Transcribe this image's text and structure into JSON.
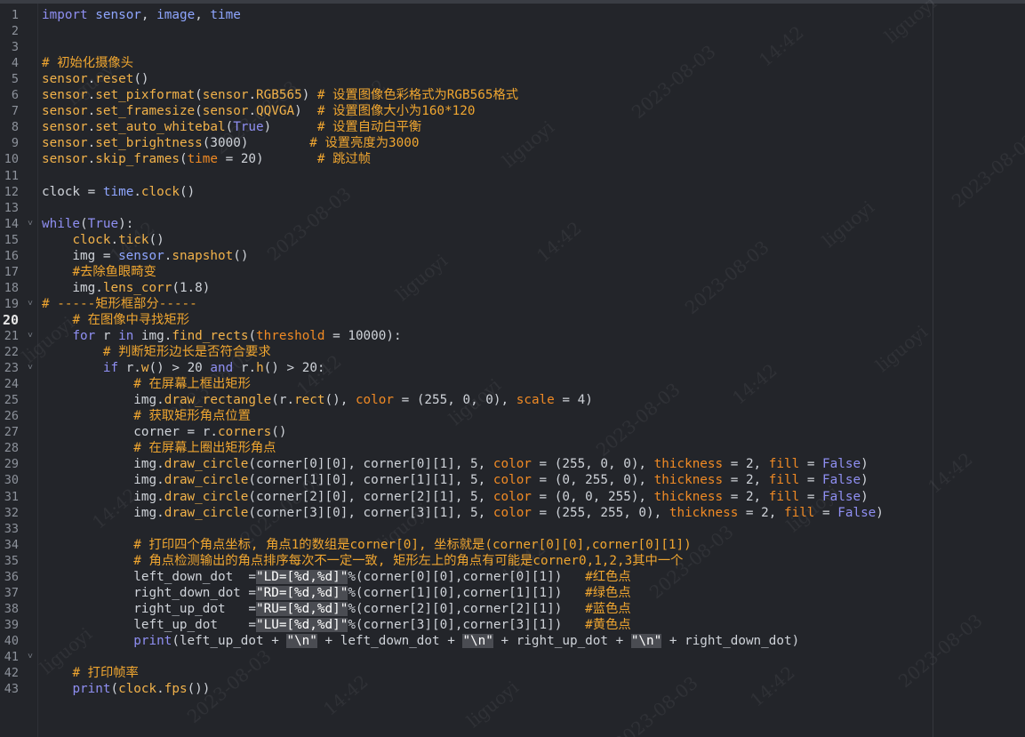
{
  "editor": {
    "current_line": 20,
    "watermarks": [
      "liguoyi",
      "2023-08-03",
      "14:42"
    ],
    "lines": [
      {
        "n": "1",
        "fold": "",
        "tokens": [
          [
            "kw",
            "import"
          ],
          [
            "def",
            " "
          ],
          [
            "mod",
            "sensor"
          ],
          [
            "def",
            ", "
          ],
          [
            "mod",
            "image"
          ],
          [
            "def",
            ", "
          ],
          [
            "mod",
            "time"
          ]
        ]
      },
      {
        "n": "2",
        "fold": "",
        "tokens": []
      },
      {
        "n": "3",
        "fold": "",
        "tokens": []
      },
      {
        "n": "4",
        "fold": "",
        "tokens": [
          [
            "cmt",
            "# 初始化摄像头"
          ]
        ]
      },
      {
        "n": "5",
        "fold": "",
        "tokens": [
          [
            "fn",
            "sensor"
          ],
          [
            "def",
            "."
          ],
          [
            "fn",
            "reset"
          ],
          [
            "def",
            "()"
          ]
        ]
      },
      {
        "n": "6",
        "fold": "",
        "tokens": [
          [
            "fn",
            "sensor"
          ],
          [
            "def",
            "."
          ],
          [
            "fn",
            "set_pixformat"
          ],
          [
            "def",
            "("
          ],
          [
            "fn",
            "sensor"
          ],
          [
            "def",
            "."
          ],
          [
            "fn",
            "RGB565"
          ],
          [
            "def",
            ") "
          ],
          [
            "cmt",
            "# 设置图像色彩格式为RGB565格式"
          ]
        ]
      },
      {
        "n": "7",
        "fold": "",
        "tokens": [
          [
            "fn",
            "sensor"
          ],
          [
            "def",
            "."
          ],
          [
            "fn",
            "set_framesize"
          ],
          [
            "def",
            "("
          ],
          [
            "fn",
            "sensor"
          ],
          [
            "def",
            "."
          ],
          [
            "fn",
            "QQVGA"
          ],
          [
            "def",
            ")  "
          ],
          [
            "cmt",
            "# 设置图像大小为160*120"
          ]
        ]
      },
      {
        "n": "8",
        "fold": "",
        "tokens": [
          [
            "fn",
            "sensor"
          ],
          [
            "def",
            "."
          ],
          [
            "fn",
            "set_auto_whitebal"
          ],
          [
            "def",
            "("
          ],
          [
            "const",
            "True"
          ],
          [
            "def",
            ")      "
          ],
          [
            "cmt",
            "# 设置自动白平衡"
          ]
        ]
      },
      {
        "n": "9",
        "fold": "",
        "tokens": [
          [
            "fn",
            "sensor"
          ],
          [
            "def",
            "."
          ],
          [
            "fn",
            "set_brightness"
          ],
          [
            "def",
            "(3000)        "
          ],
          [
            "cmt",
            "# 设置亮度为3000"
          ]
        ]
      },
      {
        "n": "10",
        "fold": "",
        "tokens": [
          [
            "fn",
            "sensor"
          ],
          [
            "def",
            "."
          ],
          [
            "fn",
            "skip_frames"
          ],
          [
            "def",
            "("
          ],
          [
            "kwarg",
            "time"
          ],
          [
            "def",
            " = 20)       "
          ],
          [
            "cmt",
            "# 跳过帧"
          ]
        ]
      },
      {
        "n": "11",
        "fold": "",
        "tokens": []
      },
      {
        "n": "12",
        "fold": "",
        "tokens": [
          [
            "def",
            "clock = "
          ],
          [
            "mod",
            "time"
          ],
          [
            "def",
            "."
          ],
          [
            "fn",
            "clock"
          ],
          [
            "def",
            "()"
          ]
        ]
      },
      {
        "n": "13",
        "fold": "",
        "tokens": []
      },
      {
        "n": "14",
        "fold": "v",
        "tokens": [
          [
            "kw",
            "while"
          ],
          [
            "def",
            "("
          ],
          [
            "const",
            "True"
          ],
          [
            "def",
            "):"
          ]
        ]
      },
      {
        "n": "15",
        "fold": "",
        "tokens": [
          [
            "def",
            "    "
          ],
          [
            "fn",
            "clock"
          ],
          [
            "def",
            "."
          ],
          [
            "fn",
            "tick"
          ],
          [
            "def",
            "()"
          ]
        ]
      },
      {
        "n": "16",
        "fold": "",
        "tokens": [
          [
            "def",
            "    img = "
          ],
          [
            "mod",
            "sensor"
          ],
          [
            "def",
            "."
          ],
          [
            "fn",
            "snapshot"
          ],
          [
            "def",
            "()"
          ]
        ]
      },
      {
        "n": "17",
        "fold": "",
        "tokens": [
          [
            "def",
            "    "
          ],
          [
            "cmt",
            "#去除鱼眼畸变"
          ]
        ]
      },
      {
        "n": "18",
        "fold": "",
        "tokens": [
          [
            "def",
            "    img."
          ],
          [
            "fn",
            "lens_corr"
          ],
          [
            "def",
            "(1.8)"
          ]
        ]
      },
      {
        "n": "19",
        "fold": "v",
        "tokens": [
          [
            "cmt",
            "# -----矩形框部分-----"
          ]
        ]
      },
      {
        "n": "20",
        "fold": "",
        "tokens": [
          [
            "def",
            "    "
          ],
          [
            "cmt",
            "# 在图像中寻找矩形"
          ]
        ]
      },
      {
        "n": "21",
        "fold": "v",
        "tokens": [
          [
            "def",
            "    "
          ],
          [
            "kw",
            "for"
          ],
          [
            "def",
            " r "
          ],
          [
            "kw",
            "in"
          ],
          [
            "def",
            " img."
          ],
          [
            "fn",
            "find_rects"
          ],
          [
            "def",
            "("
          ],
          [
            "kwarg",
            "threshold"
          ],
          [
            "def",
            " = 10000):"
          ]
        ]
      },
      {
        "n": "22",
        "fold": "",
        "tokens": [
          [
            "def",
            "        "
          ],
          [
            "cmt",
            "# 判断矩形边长是否符合要求"
          ]
        ]
      },
      {
        "n": "23",
        "fold": "v",
        "tokens": [
          [
            "def",
            "        "
          ],
          [
            "kw",
            "if"
          ],
          [
            "def",
            " r."
          ],
          [
            "fn",
            "w"
          ],
          [
            "def",
            "() > 20 "
          ],
          [
            "kw",
            "and"
          ],
          [
            "def",
            " r."
          ],
          [
            "fn",
            "h"
          ],
          [
            "def",
            "() > 20:"
          ]
        ]
      },
      {
        "n": "24",
        "fold": "",
        "tokens": [
          [
            "def",
            "            "
          ],
          [
            "cmt",
            "# 在屏幕上框出矩形"
          ]
        ]
      },
      {
        "n": "25",
        "fold": "",
        "tokens": [
          [
            "def",
            "            img."
          ],
          [
            "fn",
            "draw_rectangle"
          ],
          [
            "def",
            "(r."
          ],
          [
            "fn",
            "rect"
          ],
          [
            "def",
            "(), "
          ],
          [
            "kwarg",
            "color"
          ],
          [
            "def",
            " = (255, 0, 0), "
          ],
          [
            "kwarg",
            "scale"
          ],
          [
            "def",
            " = 4)"
          ]
        ]
      },
      {
        "n": "26",
        "fold": "",
        "tokens": [
          [
            "def",
            "            "
          ],
          [
            "cmt",
            "# 获取矩形角点位置"
          ]
        ]
      },
      {
        "n": "27",
        "fold": "",
        "tokens": [
          [
            "def",
            "            corner = r."
          ],
          [
            "fn",
            "corners"
          ],
          [
            "def",
            "()"
          ]
        ]
      },
      {
        "n": "28",
        "fold": "",
        "tokens": [
          [
            "def",
            "            "
          ],
          [
            "cmt",
            "# 在屏幕上圈出矩形角点"
          ]
        ]
      },
      {
        "n": "29",
        "fold": "",
        "tokens": [
          [
            "def",
            "            img."
          ],
          [
            "fn",
            "draw_circle"
          ],
          [
            "def",
            "(corner[0][0], corner[0][1], 5, "
          ],
          [
            "kwarg",
            "color"
          ],
          [
            "def",
            " = (255, 0, 0), "
          ],
          [
            "kwarg",
            "thickness"
          ],
          [
            "def",
            " = 2, "
          ],
          [
            "kwarg",
            "fill"
          ],
          [
            "def",
            " = "
          ],
          [
            "const",
            "False"
          ],
          [
            "def",
            ")"
          ]
        ]
      },
      {
        "n": "30",
        "fold": "",
        "tokens": [
          [
            "def",
            "            img."
          ],
          [
            "fn",
            "draw_circle"
          ],
          [
            "def",
            "(corner[1][0], corner[1][1], 5, "
          ],
          [
            "kwarg",
            "color"
          ],
          [
            "def",
            " = (0, 255, 0), "
          ],
          [
            "kwarg",
            "thickness"
          ],
          [
            "def",
            " = 2, "
          ],
          [
            "kwarg",
            "fill"
          ],
          [
            "def",
            " = "
          ],
          [
            "const",
            "False"
          ],
          [
            "def",
            ")"
          ]
        ]
      },
      {
        "n": "31",
        "fold": "",
        "tokens": [
          [
            "def",
            "            img."
          ],
          [
            "fn",
            "draw_circle"
          ],
          [
            "def",
            "(corner[2][0], corner[2][1], 5, "
          ],
          [
            "kwarg",
            "color"
          ],
          [
            "def",
            " = (0, 0, 255), "
          ],
          [
            "kwarg",
            "thickness"
          ],
          [
            "def",
            " = 2, "
          ],
          [
            "kwarg",
            "fill"
          ],
          [
            "def",
            " = "
          ],
          [
            "const",
            "False"
          ],
          [
            "def",
            ")"
          ]
        ]
      },
      {
        "n": "32",
        "fold": "",
        "tokens": [
          [
            "def",
            "            img."
          ],
          [
            "fn",
            "draw_circle"
          ],
          [
            "def",
            "(corner[3][0], corner[3][1], 5, "
          ],
          [
            "kwarg",
            "color"
          ],
          [
            "def",
            " = (255, 255, 0), "
          ],
          [
            "kwarg",
            "thickness"
          ],
          [
            "def",
            " = 2, "
          ],
          [
            "kwarg",
            "fill"
          ],
          [
            "def",
            " = "
          ],
          [
            "const",
            "False"
          ],
          [
            "def",
            ")"
          ]
        ]
      },
      {
        "n": "33",
        "fold": "",
        "tokens": []
      },
      {
        "n": "34",
        "fold": "",
        "tokens": [
          [
            "def",
            "            "
          ],
          [
            "cmt",
            "# 打印四个角点坐标, 角点1的数组是corner[0], 坐标就是(corner[0][0],corner[0][1])"
          ]
        ]
      },
      {
        "n": "35",
        "fold": "",
        "tokens": [
          [
            "def",
            "            "
          ],
          [
            "cmt",
            "# 角点检测输出的角点排序每次不一定一致, 矩形左上的角点有可能是corner0,1,2,3其中一个"
          ]
        ]
      },
      {
        "n": "36",
        "fold": "",
        "tokens": [
          [
            "def",
            "            left_down_dot  ="
          ],
          [
            "str",
            "\"LD=[%d,%d]\""
          ],
          [
            "def",
            "%(corner[0][0],corner[0][1])   "
          ],
          [
            "cmt",
            "#红色点"
          ]
        ]
      },
      {
        "n": "37",
        "fold": "",
        "tokens": [
          [
            "def",
            "            right_down_dot ="
          ],
          [
            "str",
            "\"RD=[%d,%d]\""
          ],
          [
            "def",
            "%(corner[1][0],corner[1][1])   "
          ],
          [
            "cmt",
            "#绿色点"
          ]
        ]
      },
      {
        "n": "38",
        "fold": "",
        "tokens": [
          [
            "def",
            "            right_up_dot   ="
          ],
          [
            "str",
            "\"RU=[%d,%d]\""
          ],
          [
            "def",
            "%(corner[2][0],corner[2][1])   "
          ],
          [
            "cmt",
            "#蓝色点"
          ]
        ]
      },
      {
        "n": "39",
        "fold": "",
        "tokens": [
          [
            "def",
            "            left_up_dot    ="
          ],
          [
            "str",
            "\"LU=[%d,%d]\""
          ],
          [
            "def",
            "%(corner[3][0],corner[3][1])   "
          ],
          [
            "cmt",
            "#黄色点"
          ]
        ]
      },
      {
        "n": "40",
        "fold": "",
        "tokens": [
          [
            "def",
            "            "
          ],
          [
            "kw",
            "print"
          ],
          [
            "def",
            "(left_up_dot + "
          ],
          [
            "str",
            "\"\\n\""
          ],
          [
            "def",
            " + left_down_dot + "
          ],
          [
            "str",
            "\"\\n\""
          ],
          [
            "def",
            " + right_up_dot + "
          ],
          [
            "str",
            "\"\\n\""
          ],
          [
            "def",
            " + right_down_dot)"
          ]
        ]
      },
      {
        "n": "41",
        "fold": "v",
        "tokens": []
      },
      {
        "n": "42",
        "fold": "",
        "tokens": [
          [
            "def",
            "    "
          ],
          [
            "cmt",
            "# 打印帧率"
          ]
        ]
      },
      {
        "n": "43",
        "fold": "",
        "tokens": [
          [
            "def",
            "    "
          ],
          [
            "kw",
            "print"
          ],
          [
            "def",
            "("
          ],
          [
            "fn",
            "clock"
          ],
          [
            "def",
            "."
          ],
          [
            "fn",
            "fps"
          ],
          [
            "def",
            "())"
          ]
        ]
      }
    ]
  }
}
